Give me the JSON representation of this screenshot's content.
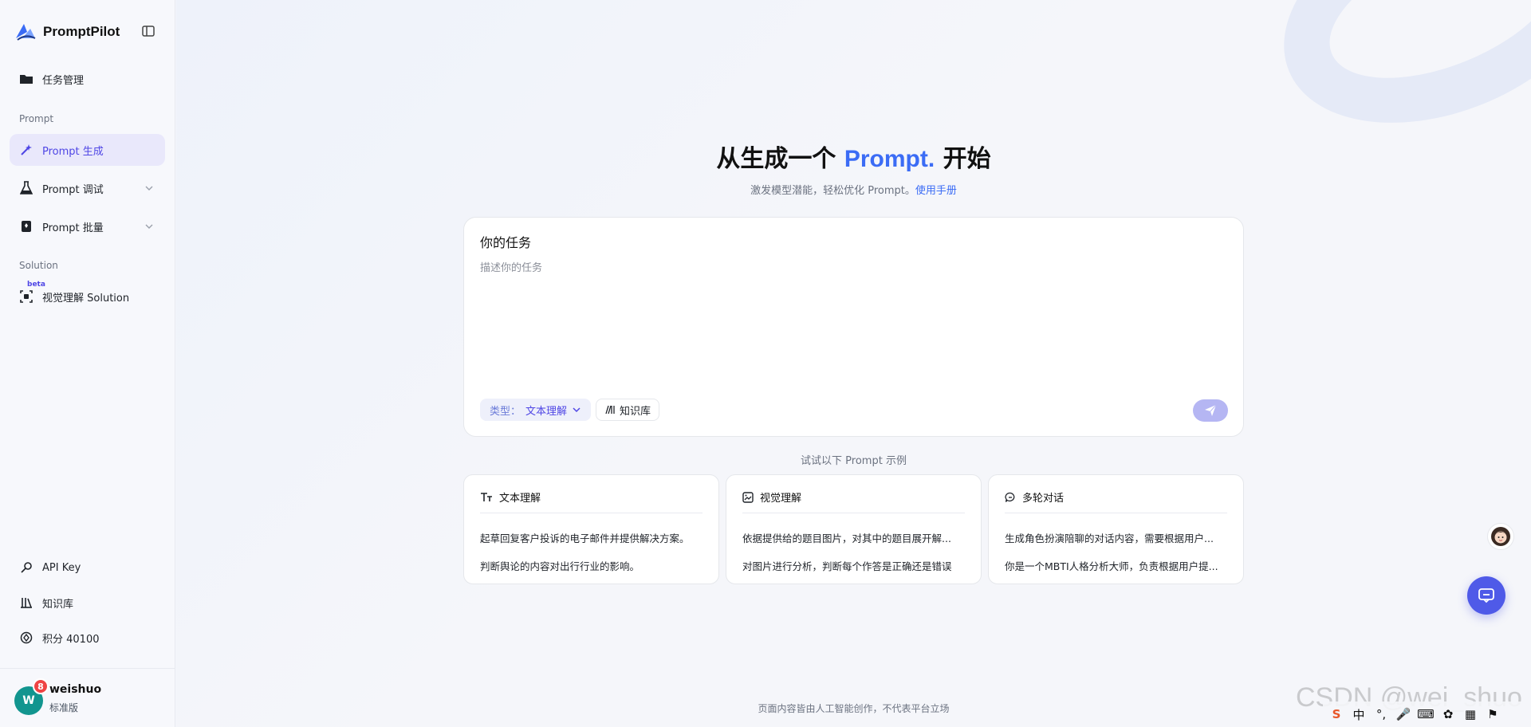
{
  "brand": {
    "name": "PromptPilot"
  },
  "sidebar": {
    "task_management": "任务管理",
    "section_prompt": "Prompt",
    "prompt_generate": "Prompt 生成",
    "prompt_debug": "Prompt 调试",
    "prompt_batch": "Prompt 批量",
    "section_solution": "Solution",
    "vision_solution": "视觉理解 Solution",
    "beta": "beta",
    "api_key": "API Key",
    "knowledge_base": "知识库",
    "points": "积分 40100",
    "user": {
      "initial": "W",
      "name": "weishuo",
      "plan": "标准版",
      "notifications": "8"
    }
  },
  "hero": {
    "title_prefix": "从生成一个",
    "title_accent": "Prompt.",
    "title_suffix": "开始",
    "subtitle": "激发模型潜能，轻松优化 Prompt。",
    "manual_link": "使用手册"
  },
  "task": {
    "label": "你的任务",
    "placeholder": "描述你的任务",
    "type_key": "类型：",
    "type_value": "文本理解",
    "kb_button": "知识库"
  },
  "examples": {
    "label": "试试以下 Prompt 示例",
    "cards": [
      {
        "title": "文本理解",
        "lines": [
          "起草回复客户投诉的电子邮件并提供解决方案。",
          "判断舆论的内容对出行行业的影响。"
        ]
      },
      {
        "title": "视觉理解",
        "lines": [
          "依据提供给的题目图片，对其中的题目展开解...",
          "对图片进行分析，判断每个作答是正确还是错误"
        ]
      },
      {
        "title": "多轮对话",
        "lines": [
          "生成角色扮演陪聊的对话内容，需要根据用户...",
          "你是一个MBTI人格分析大师，负责根据用户提..."
        ]
      }
    ]
  },
  "footer": {
    "note": "页面内容皆由人工智能创作，不代表平台立场"
  },
  "watermark": "CSDN @wei_shuo",
  "tray": [
    "S",
    "中",
    "°,",
    "🎤",
    "⌨",
    "✿",
    "▦",
    "⚑"
  ],
  "colors": {
    "accent": "#3b6cf5",
    "active_bg": "#e9e8fb",
    "send": "#b5b6f3",
    "fab": "#4f5ae8"
  },
  "icons": {
    "logo": "pilot-logo-icon",
    "collapse": "sidebar-collapse-icon",
    "folder": "folder-icon",
    "generate": "magic-wand-icon",
    "debug": "flask-icon",
    "batch": "batch-doc-icon",
    "vision": "scan-box-icon",
    "key": "key-icon",
    "books": "books-icon",
    "points": "coin-icon",
    "send": "paper-plane-icon",
    "chat": "chat-bubble-icon"
  }
}
